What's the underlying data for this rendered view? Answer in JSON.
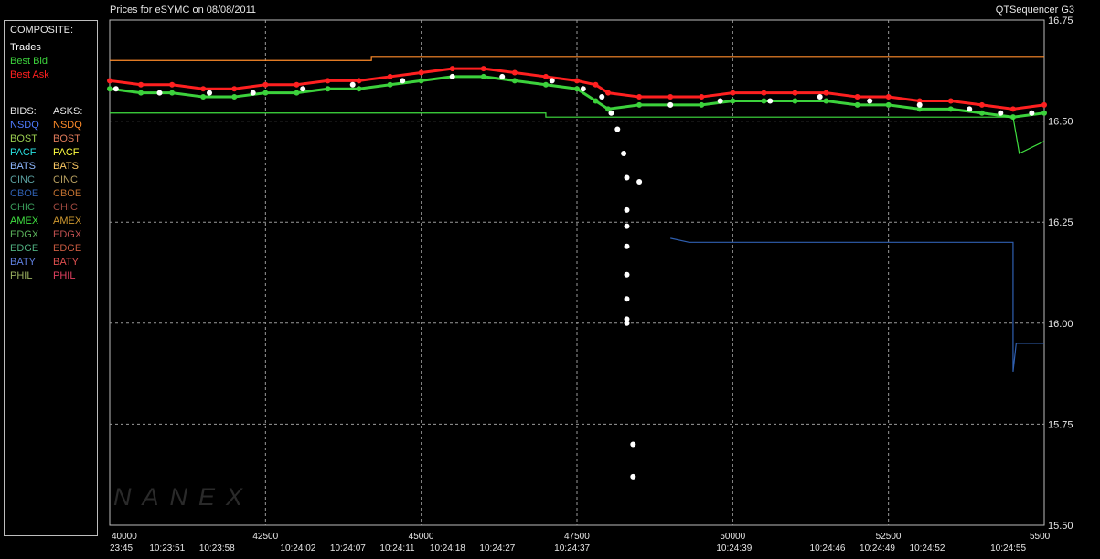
{
  "header": {
    "title_left": "Prices for  eSYMC  on  08/08/2011",
    "title_right": "QTSequencer G3"
  },
  "legend": {
    "composite_heading": "COMPOSITE:",
    "composite": [
      {
        "label": "Trades",
        "color": "#ffffff"
      },
      {
        "label": "Best Bid",
        "color": "#3cd23c"
      },
      {
        "label": "Best Ask",
        "color": "#ff2020"
      }
    ],
    "bids_heading": "BIDS:",
    "asks_heading": "ASKS:",
    "exchanges": [
      {
        "bid": "NSDQ",
        "bid_color": "#4f7cff",
        "ask": "NSDQ",
        "ask_color": "#ff8c2a"
      },
      {
        "bid": "BOST",
        "bid_color": "#9acd50",
        "ask": "BOST",
        "ask_color": "#e07a5a"
      },
      {
        "bid": "PACF",
        "bid_color": "#29e0e0",
        "ask": "PACF",
        "ask_color": "#ffff40"
      },
      {
        "bid": "BATS",
        "bid_color": "#8fb8ff",
        "ask": "BATS",
        "ask_color": "#ffcc66"
      },
      {
        "bid": "CINC",
        "bid_color": "#5aa0a0",
        "ask": "CINC",
        "ask_color": "#b8a060"
      },
      {
        "bid": "CBOE",
        "bid_color": "#2f5fb0",
        "ask": "CBOE",
        "ask_color": "#c07030"
      },
      {
        "bid": "CHIC",
        "bid_color": "#3a9a5a",
        "ask": "CHIC",
        "ask_color": "#a04a40"
      },
      {
        "bid": "AMEX",
        "bid_color": "#40e040",
        "ask": "AMEX",
        "ask_color": "#d09a30"
      },
      {
        "bid": "EDGX",
        "bid_color": "#5ab05a",
        "ask": "EDGX",
        "ask_color": "#c05050"
      },
      {
        "bid": "EDGE",
        "bid_color": "#50b080",
        "ask": "EDGE",
        "ask_color": "#c85a40"
      },
      {
        "bid": "BATY",
        "bid_color": "#6080e0",
        "ask": "BATY",
        "ask_color": "#e05050"
      },
      {
        "bid": "PHIL",
        "bid_color": "#9ab060",
        "ask": "PHIL",
        "ask_color": "#e04060"
      }
    ]
  },
  "watermark": "NANEX",
  "chart_data": {
    "type": "line",
    "title": "Prices for  eSYMC  on  08/08/2011",
    "ylim": [
      15.5,
      16.75
    ],
    "xlim": [
      40000,
      55000
    ],
    "y_ticks": [
      "16.75",
      "16.50",
      "16.25",
      "16.00",
      "15.75",
      "15.50"
    ],
    "y_tick_values": [
      16.75,
      16.5,
      16.25,
      16.0,
      15.75,
      15.5
    ],
    "x_ticks": [
      {
        "value": 40000,
        "label": "40000"
      },
      {
        "value": 42500,
        "label": "42500"
      },
      {
        "value": 45000,
        "label": "45000"
      },
      {
        "value": 47500,
        "label": "47500"
      },
      {
        "value": 50000,
        "label": "50000"
      },
      {
        "value": 52500,
        "label": "52500"
      },
      {
        "value": 55000,
        "label": "5500"
      }
    ],
    "time_labels": [
      {
        "value": 40000,
        "label": "23:45"
      },
      {
        "value": 40900,
        "label": "10:23:51"
      },
      {
        "value": 41700,
        "label": "10:23:58"
      },
      {
        "value": 43000,
        "label": "10:24:02"
      },
      {
        "value": 43800,
        "label": "10:24:07"
      },
      {
        "value": 44600,
        "label": "10:24:11"
      },
      {
        "value": 45400,
        "label": "10:24:18"
      },
      {
        "value": 46200,
        "label": "10:24:27"
      },
      {
        "value": 47400,
        "label": "10:24:37"
      },
      {
        "value": 50000,
        "label": "10:24:39"
      },
      {
        "value": 51500,
        "label": "10:24:46"
      },
      {
        "value": 52300,
        "label": "10:24:49"
      },
      {
        "value": 53100,
        "label": "10:24:52"
      },
      {
        "value": 54400,
        "label": "10:24:55"
      }
    ],
    "grid": true,
    "series": [
      {
        "name": "Best Ask",
        "color": "#ff2020",
        "x": [
          40000,
          40500,
          41000,
          41500,
          42000,
          42500,
          43000,
          43500,
          44000,
          44500,
          45000,
          45500,
          46000,
          46500,
          47000,
          47500,
          47800,
          48000,
          48500,
          49000,
          49500,
          50000,
          50500,
          51000,
          51500,
          52000,
          52500,
          53000,
          53500,
          54000,
          54500,
          55000
        ],
        "y": [
          16.6,
          16.59,
          16.59,
          16.58,
          16.58,
          16.59,
          16.59,
          16.6,
          16.6,
          16.61,
          16.62,
          16.63,
          16.63,
          16.62,
          16.61,
          16.6,
          16.59,
          16.57,
          16.56,
          16.56,
          16.56,
          16.57,
          16.57,
          16.57,
          16.57,
          16.56,
          16.56,
          16.55,
          16.55,
          16.54,
          16.53,
          16.54
        ]
      },
      {
        "name": "Best Bid",
        "color": "#3cd23c",
        "x": [
          40000,
          40500,
          41000,
          41500,
          42000,
          42500,
          43000,
          43500,
          44000,
          44500,
          45000,
          45500,
          46000,
          46500,
          47000,
          47500,
          47800,
          48000,
          48500,
          49000,
          49500,
          50000,
          50500,
          51000,
          51500,
          52000,
          52500,
          53000,
          53500,
          54000,
          54500,
          55000
        ],
        "y": [
          16.58,
          16.57,
          16.57,
          16.56,
          16.56,
          16.57,
          16.57,
          16.58,
          16.58,
          16.59,
          16.6,
          16.61,
          16.61,
          16.6,
          16.59,
          16.58,
          16.55,
          16.53,
          16.54,
          16.54,
          16.54,
          16.55,
          16.55,
          16.55,
          16.55,
          16.54,
          16.54,
          16.53,
          16.53,
          16.52,
          16.51,
          16.52
        ]
      },
      {
        "name": "Trades",
        "color": "#ffffff",
        "x": [
          40100,
          40800,
          41600,
          42300,
          43100,
          43900,
          44700,
          45500,
          46300,
          47100,
          47600,
          47900,
          48050,
          48150,
          48250,
          48300,
          48500,
          48300,
          48300,
          48300,
          48300,
          48300,
          48300,
          48300,
          48400,
          48400,
          49000,
          49800,
          50600,
          51400,
          52200,
          53000,
          53800,
          54300,
          54800
        ],
        "y": [
          16.58,
          16.57,
          16.57,
          16.57,
          16.58,
          16.59,
          16.6,
          16.61,
          16.61,
          16.6,
          16.58,
          16.56,
          16.52,
          16.48,
          16.42,
          16.36,
          16.35,
          16.28,
          16.24,
          16.19,
          16.12,
          16.06,
          16.01,
          16.0,
          15.7,
          15.62,
          16.54,
          16.55,
          16.55,
          16.56,
          16.55,
          16.54,
          16.53,
          16.52,
          16.52
        ]
      },
      {
        "name": "NSDQ Ask",
        "color": "#ff8c2a",
        "x": [
          40000,
          44200,
          44200,
          55000
        ],
        "y": [
          16.65,
          16.65,
          16.66,
          16.66
        ]
      },
      {
        "name": "CBOE Bid",
        "color": "#2f5fb0",
        "x": [
          49000,
          49300,
          54500,
          54500,
          54550,
          55000
        ],
        "y": [
          16.21,
          16.2,
          16.2,
          15.88,
          15.95,
          15.95
        ]
      },
      {
        "name": "AMEX Bid",
        "color": "#40e040",
        "x": [
          40000,
          47000,
          47000,
          54500,
          54600,
          55000
        ],
        "y": [
          16.52,
          16.52,
          16.51,
          16.51,
          16.42,
          16.45
        ]
      }
    ]
  }
}
